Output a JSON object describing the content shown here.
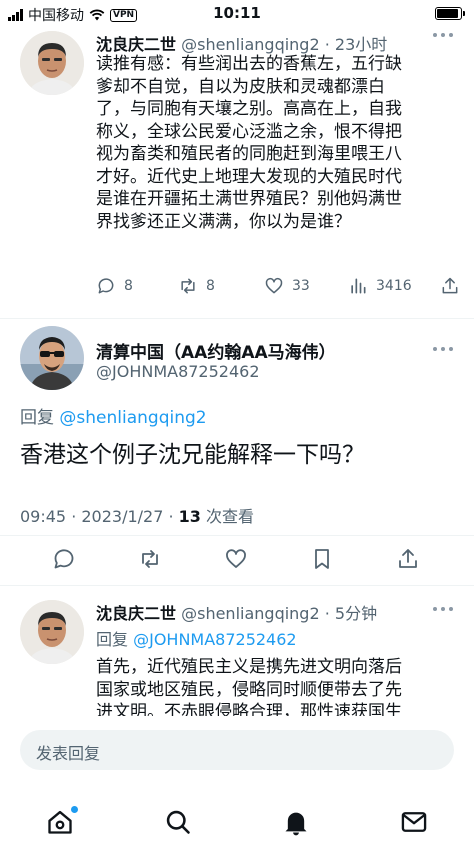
{
  "status_bar": {
    "carrier": "中国移动",
    "vpn": "VPN",
    "time": "10:11",
    "battery_level": 0.9
  },
  "tweets": [
    {
      "name": "沈良庆二世",
      "handle": "@shenliangqing2",
      "time": "· 23小时",
      "lines": [
        "读推有感：有些润出去的香蕉左，五行缺",
        "爹却不自觉，自以为皮肤和灵魂都漂白",
        "了，与同胞有天壤之别。高高在上，自我",
        "称义，全球公民爱心泛滥之余，恨不得把",
        "视为畜类和殖民者的同胞赶到海里喂王八",
        "才好。近代史上地理大发现的大殖民时代",
        "是谁在开疆拓土满世界殖民？别他妈满世",
        "界找爹还正义满满，你以为是谁？"
      ],
      "replies": "8",
      "retweets": "8",
      "likes": "33",
      "views": "3416"
    }
  ],
  "main_tweet": {
    "name": "清算中国（AA约翰AA马海伟）",
    "handle": "@JOHNMA87252462",
    "reply_prefix": "回复 ",
    "reply_to": "@shenliangqing2",
    "text": "香港这个例子沈兄能解释一下吗？",
    "timestamp": "09:45 · 2023/1/27 · ",
    "view_count": "13",
    "view_label": " 次查看"
  },
  "reply_tweet": {
    "name": "沈良庆二世",
    "handle": "@shenliangqing2",
    "time": "· 5分钟",
    "reply_prefix": "回复 ",
    "reply_to": "@JOHNMA87252462",
    "lines": [
      "首先，近代殖民主义是携先进文明向落后",
      "国家或地区殖民，侵略同时顺便带去了先",
      "进文明。不赤眼侵略合理，那性速获国生"
    ]
  },
  "compose": {
    "placeholder": "发表回复"
  },
  "colors": {
    "accent": "#1d9bf0",
    "text": "#0f1419",
    "secondary": "#536471"
  }
}
